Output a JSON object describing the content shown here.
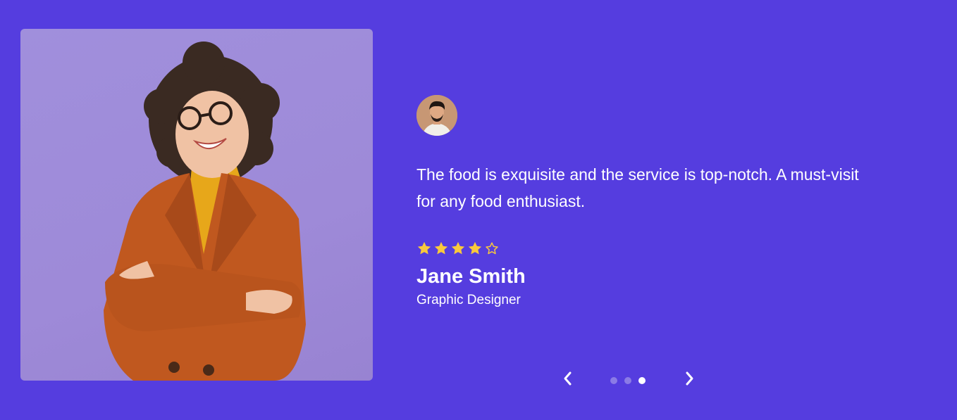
{
  "testimonial": {
    "quote": "The food is exquisite and the service is top-notch. A must-visit for any food enthusiast.",
    "rating": 4,
    "rating_max": 5,
    "name": "Jane Smith",
    "role": "Graphic Designer"
  },
  "carousel": {
    "slide_count": 3,
    "active_index": 2,
    "prev_icon": "chevron-left-icon",
    "next_icon": "chevron-right-icon"
  },
  "colors": {
    "background": "#553ddf",
    "star": "#f9c93c",
    "dot_inactive": "#8b7be6",
    "dot_active": "#ffffff"
  }
}
